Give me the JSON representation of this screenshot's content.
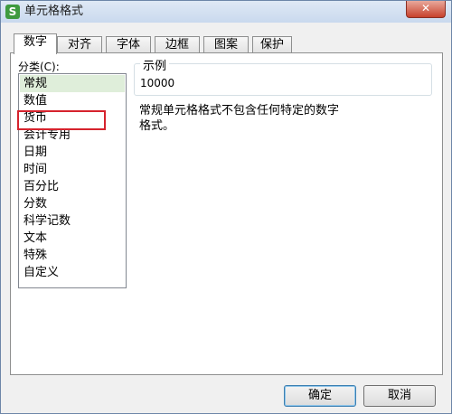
{
  "window": {
    "title": "单元格格式",
    "app_icon_letter": "S",
    "close_symbol": "✕"
  },
  "tabs": [
    {
      "label": "数字",
      "active": true
    },
    {
      "label": "对齐"
    },
    {
      "label": "字体"
    },
    {
      "label": "边框"
    },
    {
      "label": "图案"
    },
    {
      "label": "保护"
    }
  ],
  "category": {
    "label": "分类(C):",
    "items": [
      "常规",
      "数值",
      "货币",
      "会计专用",
      "日期",
      "时间",
      "百分比",
      "分数",
      "科学记数",
      "文本",
      "特殊",
      "自定义"
    ],
    "selected_index": 0,
    "highlighted_index": 2
  },
  "sample": {
    "legend": "示例",
    "value": "10000"
  },
  "description": "常规单元格格式不包含任何特定的数字格式。",
  "buttons": {
    "ok": "确定",
    "cancel": "取消"
  },
  "colors": {
    "selected_bg": "#dfeeda",
    "highlight_border": "#d6232d",
    "app_icon": "#3e9a3f"
  }
}
